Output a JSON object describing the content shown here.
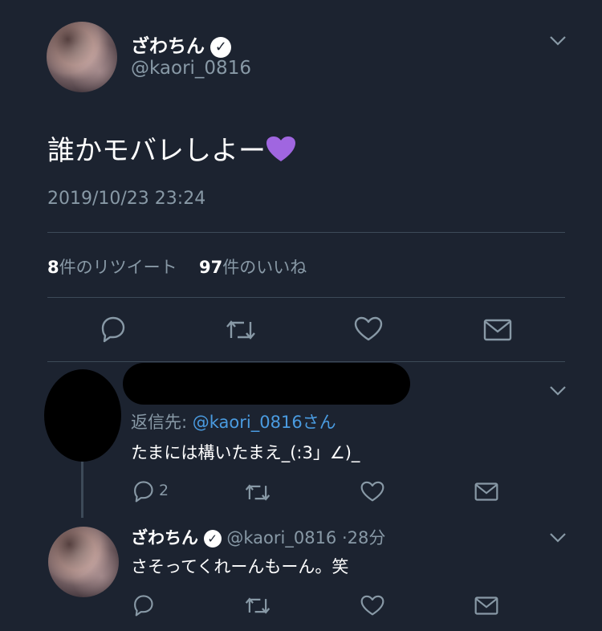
{
  "main_tweet": {
    "author_name": "ざわちん",
    "author_handle": "@kaori_0816",
    "text": "誰かモバレしよー",
    "heart_emoji": "💜",
    "timestamp": "2019/10/23 23:24",
    "retweet_count": "8",
    "retweet_label": "件のリツイート",
    "like_count": "97",
    "like_label": "件のいいね"
  },
  "reply_1": {
    "reply_to_prefix": "返信先:",
    "reply_to_handle": "@kaori_0816さん",
    "text": "たまには構いたまえ_(:3」∠)_",
    "reply_count": "2"
  },
  "reply_2": {
    "author_name": "ざわちん",
    "author_handle": "@kaori_0816",
    "separator": "·",
    "time": "28分",
    "text": "さそってくれーんもーん。笑"
  },
  "colors": {
    "background": "#1c2330",
    "muted": "#8899a6",
    "link": "#4a9be0",
    "heart": "#a066e0"
  },
  "icons": [
    "chevron-down-icon",
    "verified-icon",
    "reply-icon",
    "retweet-icon",
    "like-icon",
    "share-icon"
  ]
}
